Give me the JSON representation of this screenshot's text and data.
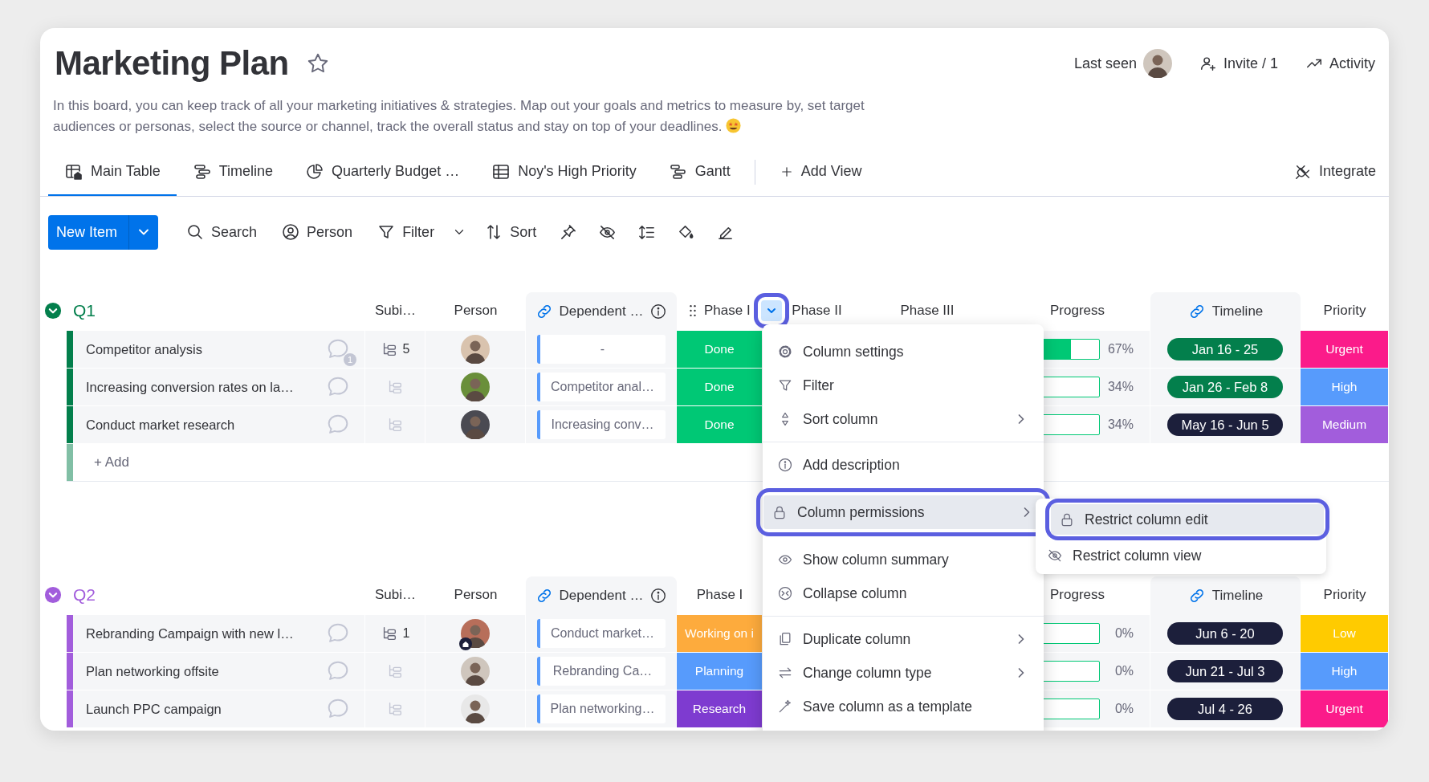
{
  "board": {
    "title": "Marketing Plan",
    "starred": false,
    "description": "In this board, you can keep track of all your marketing initiatives & strategies. Map out your goals and metrics to measure by, set target audiences or personas, select the source or channel, track the overall status and stay on top of your deadlines."
  },
  "header_actions": [
    {
      "label": "Last seen"
    },
    {
      "label": "Invite / 1"
    },
    {
      "label": "Activity"
    }
  ],
  "tabs": [
    {
      "label": "Main Table",
      "selected": true
    },
    {
      "label": "Timeline",
      "selected": false
    },
    {
      "label": "Quarterly Budget …",
      "selected": false
    },
    {
      "label": "Noy's High Priority",
      "selected": false
    },
    {
      "label": "Gantt",
      "selected": false
    }
  ],
  "add_view": "Add View",
  "integrate": "Integrate",
  "toolbar": {
    "new_item": "New Item",
    "buttons": [
      "Search",
      "Person",
      "Filter",
      "Sort"
    ]
  },
  "groups": [
    {
      "name": "Q1",
      "color": "#037f4c",
      "expanded": true,
      "add_label": "+ Add",
      "headers": [
        {
          "kind": "subitems",
          "label": "Subi…"
        },
        {
          "kind": "person",
          "label": "Person"
        },
        {
          "kind": "dependent",
          "label": "Dependent …",
          "linked": true,
          "info": true
        },
        {
          "kind": "phase1",
          "label": "Phase I",
          "drag_handle": true,
          "menu_open": true,
          "highlighted": true
        },
        {
          "kind": "phase2",
          "label": "Phase II"
        },
        {
          "kind": "phase3",
          "label": "Phase III"
        },
        {
          "kind": "progress",
          "label": "Progress"
        },
        {
          "kind": "timeline",
          "label": "Timeline",
          "linked": true
        },
        {
          "kind": "priority",
          "label": "Priority"
        }
      ],
      "rows": [
        {
          "name": "Competitor analysis",
          "comments": "1",
          "subitems": "5",
          "dependency": "-",
          "phase": {
            "label": "Done",
            "color": "#00c875"
          },
          "progress": {
            "level": 0.67,
            "reading": "67%"
          },
          "timeline": {
            "label": "Jan 16 - 25",
            "color": "#037f4c"
          },
          "priority": {
            "label": "Urgent",
            "color": "#fb1b8a"
          }
        },
        {
          "name": "Increasing conversion rates on la…",
          "dependency": "Competitor anal…",
          "phase": {
            "label": "Done",
            "color": "#00c875"
          },
          "progress": {
            "level": 0.34,
            "reading": "34%"
          },
          "timeline": {
            "label": "Jan 26 - Feb 8",
            "color": "#037f4c"
          },
          "priority": {
            "label": "High",
            "color": "#579bfc"
          }
        },
        {
          "name": "Conduct market research",
          "dependency": "Increasing conv…",
          "phase": {
            "label": "Done",
            "color": "#00c875"
          },
          "progress": {
            "level": 0.34,
            "reading": "34%"
          },
          "timeline": {
            "label": "May 16 - Jun 5",
            "color": "#1c1f3b"
          },
          "priority": {
            "label": "Medium",
            "color": "#a25ddc"
          }
        }
      ]
    },
    {
      "name": "Q2",
      "color": "#a25ddc",
      "expanded": true,
      "headers": [
        {
          "kind": "subitems",
          "label": "Subi…"
        },
        {
          "kind": "person",
          "label": "Person"
        },
        {
          "kind": "dependent",
          "label": "Dependent …",
          "linked": true,
          "info": true
        },
        {
          "kind": "phase1",
          "label": "Phase I"
        },
        {
          "kind": "progress",
          "label": "Progress"
        },
        {
          "kind": "timeline",
          "label": "Timeline",
          "linked": true
        },
        {
          "kind": "priority",
          "label": "Priority"
        }
      ],
      "rows": [
        {
          "name": "Rebranding Campaign with new l…",
          "subitems": "1",
          "avatar_badge": true,
          "dependency": "Conduct market…",
          "phase": {
            "label": "Working on i",
            "color": "#fdab3d"
          },
          "progress": {
            "level": 0,
            "reading": "0%"
          },
          "timeline": {
            "label": "Jun 6 - 20",
            "color": "#1c1f3b"
          },
          "priority": {
            "label": "Low",
            "color": "#ffcb00"
          }
        },
        {
          "name": "Plan networking offsite",
          "dependency": "Rebranding Ca…",
          "phase": {
            "label": "Planning",
            "color": "#579bfc"
          },
          "progress": {
            "level": 0,
            "reading": "0%"
          },
          "timeline": {
            "label": "Jun 21 - Jul 3",
            "color": "#1c1f3b"
          },
          "priority": {
            "label": "High",
            "color": "#579bfc"
          }
        },
        {
          "name": "Launch PPC campaign",
          "dependency": "Plan networking…",
          "phase": {
            "label": "Research",
            "color": "#7e3bd0"
          },
          "progress": {
            "level": 0,
            "reading": "0%"
          },
          "timeline": {
            "label": "Jul 4 - 26",
            "color": "#1c1f3b"
          },
          "priority": {
            "label": "Urgent",
            "color": "#fb1b8a"
          }
        }
      ]
    }
  ],
  "column_menu": {
    "items": [
      {
        "kind": "item",
        "label": "Column settings",
        "selected": false
      },
      {
        "kind": "item",
        "label": "Filter",
        "selected": false
      },
      {
        "kind": "item",
        "label": "Sort column",
        "submenu": true,
        "selected": false
      },
      {
        "kind": "divider"
      },
      {
        "kind": "item",
        "label": "Add description",
        "selected": false
      },
      {
        "kind": "item",
        "label": "Column permissions",
        "submenu": true,
        "selected": true,
        "highlighted": true
      },
      {
        "kind": "item",
        "label": "Show column summary",
        "selected": false
      },
      {
        "kind": "item",
        "label": "Collapse column",
        "selected": false
      },
      {
        "kind": "divider"
      },
      {
        "kind": "item",
        "label": "Duplicate column",
        "submenu": true,
        "selected": false
      },
      {
        "kind": "item",
        "label": "Change column type",
        "submenu": true,
        "selected": false
      },
      {
        "kind": "item",
        "label": "Save column as a template",
        "selected": false
      }
    ],
    "submenu": [
      {
        "label": "Restrict column edit",
        "selected": true,
        "highlighted": true
      },
      {
        "label": "Restrict column view",
        "selected": false
      }
    ]
  }
}
